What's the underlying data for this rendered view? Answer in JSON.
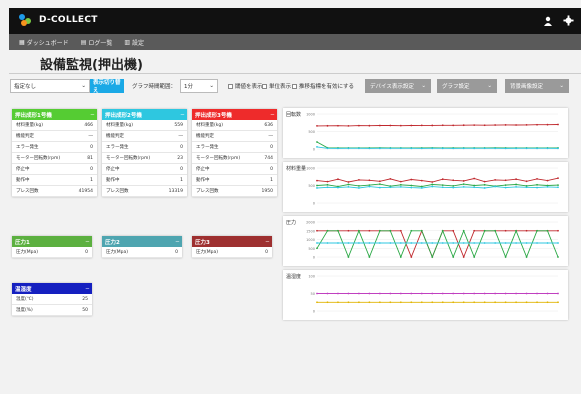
{
  "app": {
    "logo": "D-COLLECT"
  },
  "nav": {
    "items": [
      "ダッシュボード",
      "ログ一覧",
      "設定"
    ]
  },
  "page": {
    "title": "設備監視(押出機)"
  },
  "toolbar": {
    "filter_select": "指定なし",
    "switch_btn": "表示切り替え",
    "period_label": "グラフ時間範囲：",
    "period_select": "1分",
    "checks": [
      "閾値を表示",
      "単位表示",
      "推移指標を有効にする"
    ],
    "device_btn": "デバイス表示設定",
    "graph_btn": "グラフ設定",
    "bg_btn": "背景画像設定"
  },
  "colors": {
    "green": "#55cc33",
    "cyan": "#2ec7e0",
    "red": "#ee2b2b",
    "green2": "#5cb040",
    "teal": "#4ea5b0",
    "darkred": "#9e3030",
    "blue": "#1520c0"
  },
  "extruders": [
    {
      "title": "押出成形1号機",
      "color": "green",
      "rows": [
        [
          "材料重量(kg)",
          "466"
        ],
        [
          "機能判定",
          "―"
        ],
        [
          "エラー発生",
          "0"
        ],
        [
          "モーター回転数(rpm)",
          "81"
        ],
        [
          "停止中",
          "0"
        ],
        [
          "動作中",
          "1"
        ],
        [
          "プレス回数",
          "41954"
        ]
      ]
    },
    {
      "title": "押出成形2号機",
      "color": "cyan",
      "rows": [
        [
          "材料重量(kg)",
          "559"
        ],
        [
          "機能判定",
          "―"
        ],
        [
          "エラー発生",
          "0"
        ],
        [
          "モーター回転数(rpm)",
          "23"
        ],
        [
          "停止中",
          "0"
        ],
        [
          "動作中",
          "1"
        ],
        [
          "プレス回数",
          "13319"
        ]
      ]
    },
    {
      "title": "押出成形3号機",
      "color": "red",
      "rows": [
        [
          "材料重量(kg)",
          "636"
        ],
        [
          "機能判定",
          "―"
        ],
        [
          "エラー発生",
          "0"
        ],
        [
          "モーター回転数(rpm)",
          "744"
        ],
        [
          "停止中",
          "0"
        ],
        [
          "動作中",
          "1"
        ],
        [
          "プレス回数",
          "1950"
        ]
      ]
    }
  ],
  "pressures": [
    {
      "title": "圧力1",
      "color": "green2",
      "label": "圧力(Mpa)",
      "value": "0"
    },
    {
      "title": "圧力2",
      "color": "teal",
      "label": "圧力(Mpa)",
      "value": "0"
    },
    {
      "title": "圧力3",
      "color": "darkred",
      "label": "圧力(Mpa)",
      "value": "0"
    }
  ],
  "temp": {
    "title": "温湿度",
    "color": "blue",
    "rows": [
      [
        "温度(℃)",
        "25"
      ],
      [
        "湿度(%)",
        "50"
      ]
    ]
  },
  "charts": [
    {
      "title": "回転数"
    },
    {
      "title": "材料重量"
    },
    {
      "title": "圧力"
    },
    {
      "title": "温湿度"
    }
  ],
  "chart_data": [
    {
      "type": "line",
      "title": "回転数",
      "ylim": [
        0,
        1000
      ],
      "y_ticks": [
        "1000",
        "500",
        "0"
      ],
      "series": [
        {
          "color": "#c0282d",
          "values": [
            660,
            662,
            665,
            661,
            668,
            666,
            670,
            672,
            667,
            671,
            675,
            673,
            678,
            676,
            680,
            682,
            679,
            684,
            688,
            686,
            690,
            693,
            695,
            700
          ]
        },
        {
          "color": "#2aa845",
          "values": [
            200,
            35,
            30,
            32,
            30,
            31,
            33,
            30,
            31,
            32,
            30,
            33,
            31,
            30,
            32,
            31,
            30,
            33,
            31,
            30,
            32,
            31,
            30,
            31
          ]
        },
        {
          "color": "#2ec7e0",
          "values": [
            60,
            20,
            18,
            19,
            20,
            18,
            19,
            20,
            21,
            19,
            18,
            20,
            19,
            18,
            20,
            19,
            21,
            20,
            18,
            19,
            20,
            19,
            20,
            18
          ]
        }
      ]
    },
    {
      "type": "line",
      "title": "材料重量",
      "ylim": [
        0,
        1000
      ],
      "y_ticks": [
        "1000",
        "500",
        "0"
      ],
      "series": [
        {
          "color": "#c0282d",
          "values": [
            640,
            610,
            680,
            600,
            660,
            650,
            620,
            690,
            610,
            670,
            640,
            600,
            680,
            650,
            630,
            700,
            610,
            660,
            650,
            680,
            620,
            690,
            640,
            710
          ]
        },
        {
          "color": "#2aa845",
          "values": [
            500,
            520,
            470,
            530,
            490,
            510,
            540,
            480,
            520,
            500,
            470,
            530,
            510,
            490,
            540,
            500,
            520,
            480,
            510,
            530,
            490,
            520,
            500,
            510
          ]
        },
        {
          "color": "#2ec7e0",
          "values": [
            430,
            450,
            440,
            460,
            430,
            470,
            440,
            450,
            460,
            440,
            430,
            470,
            450,
            440,
            460,
            450,
            430,
            470,
            440,
            460,
            450,
            440,
            460,
            450
          ]
        }
      ]
    },
    {
      "type": "line",
      "title": "圧力",
      "ylim": [
        0,
        2000
      ],
      "y_ticks": [
        "2000",
        "1500",
        "1000",
        "500",
        "0"
      ],
      "series": [
        {
          "color": "#c0282d",
          "values": [
            1500,
            1500,
            1500,
            1500,
            1500,
            1500,
            1500,
            1500,
            1500,
            0,
            1500,
            0,
            1500,
            1500,
            0,
            1500,
            1500,
            1500,
            1500,
            1500,
            1500,
            1500,
            1500,
            1500
          ]
        },
        {
          "color": "#2aa845",
          "values": [
            500,
            1500,
            1500,
            0,
            1500,
            0,
            1500,
            1500,
            0,
            1500,
            1500,
            0,
            1500,
            0,
            1500,
            0,
            1500,
            1500,
            0,
            1500,
            0,
            1500,
            1500,
            0
          ]
        },
        {
          "color": "#2ec7e0",
          "values": [
            800,
            800,
            800,
            800,
            800,
            800,
            800,
            800,
            800,
            800,
            800,
            800,
            800,
            800,
            800,
            800,
            800,
            800,
            800,
            800,
            800,
            800,
            800,
            800
          ]
        }
      ]
    },
    {
      "type": "line",
      "title": "温湿度",
      "ylim": [
        0,
        100
      ],
      "y_ticks": [
        "100",
        "50",
        "0"
      ],
      "series": [
        {
          "color": "#c040c0",
          "values": [
            50,
            50,
            50,
            50,
            50,
            50,
            50,
            50,
            50,
            50,
            50,
            50,
            50,
            50,
            50,
            50,
            50,
            50,
            50,
            50,
            50,
            50,
            50,
            50
          ]
        },
        {
          "color": "#e0b400",
          "values": [
            25,
            25,
            25,
            25,
            25,
            25,
            25,
            25,
            25,
            25,
            25,
            25,
            25,
            25,
            25,
            25,
            25,
            25,
            25,
            25,
            25,
            25,
            25,
            25
          ]
        }
      ]
    }
  ]
}
